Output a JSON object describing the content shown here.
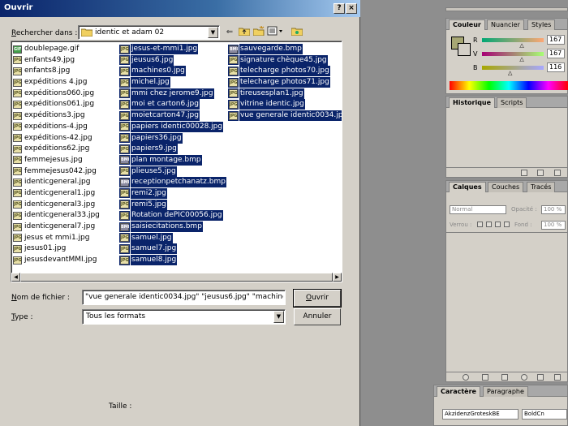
{
  "dialog": {
    "title": "Ouvrir",
    "help_glyph": "?",
    "close_glyph": "×",
    "look_in_label_u": "R",
    "look_in_label_rest": "echercher dans :",
    "look_in_value": "identic et adam 02",
    "toolbar_icons": [
      "back-icon",
      "up-folder-icon",
      "new-folder-icon",
      "view-menu-icon",
      "favorites-icon"
    ],
    "files": [
      [
        {
          "name": "doublepage.gif",
          "type": "gif",
          "selected": false
        },
        {
          "name": "enfants49.jpg",
          "type": "jpg",
          "selected": false
        },
        {
          "name": "enfants8.jpg",
          "type": "jpg",
          "selected": false
        },
        {
          "name": "expéditions 4.jpg",
          "type": "jpg",
          "selected": false
        },
        {
          "name": "expéditions060.jpg",
          "type": "jpg",
          "selected": false
        },
        {
          "name": "expéditions061.jpg",
          "type": "jpg",
          "selected": false
        },
        {
          "name": "expéditions3.jpg",
          "type": "jpg",
          "selected": false
        },
        {
          "name": "expéditions-4.jpg",
          "type": "jpg",
          "selected": false
        },
        {
          "name": "expéditions-42.jpg",
          "type": "jpg",
          "selected": false
        },
        {
          "name": "expéditions62.jpg",
          "type": "jpg",
          "selected": false
        },
        {
          "name": "femmejesus.jpg",
          "type": "jpg",
          "selected": false
        },
        {
          "name": "femmejesus042.jpg",
          "type": "jpg",
          "selected": false
        },
        {
          "name": "identicgeneral.jpg",
          "type": "jpg",
          "selected": false
        },
        {
          "name": "identicgeneral1.jpg",
          "type": "jpg",
          "selected": false
        },
        {
          "name": "identicgeneral3.jpg",
          "type": "jpg",
          "selected": false
        },
        {
          "name": "identicgeneral33.jpg",
          "type": "jpg",
          "selected": false
        },
        {
          "name": "identicgeneral7.jpg",
          "type": "jpg",
          "selected": false
        },
        {
          "name": "jesus et mmi1.jpg",
          "type": "jpg",
          "selected": false
        },
        {
          "name": "jesus01.jpg",
          "type": "jpg",
          "selected": false
        },
        {
          "name": "jesusdevantMMI.jpg",
          "type": "jpg",
          "selected": false
        }
      ],
      [
        {
          "name": "jesus-et-mmi1.jpg",
          "type": "jpg",
          "selected": true
        },
        {
          "name": "jeusus6.jpg",
          "type": "jpg",
          "selected": true
        },
        {
          "name": "machines0.jpg",
          "type": "jpg",
          "selected": true
        },
        {
          "name": "michel.jpg",
          "type": "jpg",
          "selected": true
        },
        {
          "name": "mmi chez jerome9.jpg",
          "type": "jpg",
          "selected": true
        },
        {
          "name": "moi et carton6.jpg",
          "type": "jpg",
          "selected": true
        },
        {
          "name": "moietcarton47.jpg",
          "type": "jpg",
          "selected": true
        },
        {
          "name": "papiers identic00028.jpg",
          "type": "jpg",
          "selected": true
        },
        {
          "name": "papiers36.jpg",
          "type": "jpg",
          "selected": true
        },
        {
          "name": "papiers9.jpg",
          "type": "jpg",
          "selected": true
        },
        {
          "name": "plan montage.bmp",
          "type": "bmp",
          "selected": true
        },
        {
          "name": "plieuse5.jpg",
          "type": "jpg",
          "selected": true
        },
        {
          "name": "receptionpetchanatz.bmp",
          "type": "bmp",
          "selected": true
        },
        {
          "name": "remi2.jpg",
          "type": "jpg",
          "selected": true
        },
        {
          "name": "remi5.jpg",
          "type": "jpg",
          "selected": true
        },
        {
          "name": "Rotation dePIC00056.jpg",
          "type": "jpg",
          "selected": true
        },
        {
          "name": "saisiecitations.bmp",
          "type": "bmp",
          "selected": true
        },
        {
          "name": "samuel.jpg",
          "type": "jpg",
          "selected": true
        },
        {
          "name": "samuel7.jpg",
          "type": "jpg",
          "selected": true
        },
        {
          "name": "samuel8.jpg",
          "type": "jpg",
          "selected": true
        }
      ],
      [
        {
          "name": "sauvegarde.bmp",
          "type": "bmp",
          "selected": true
        },
        {
          "name": "signature chèque45.jpg",
          "type": "jpg",
          "selected": true
        },
        {
          "name": "telecharge photos70.jpg",
          "type": "jpg",
          "selected": true
        },
        {
          "name": "telecharge photos71.jpg",
          "type": "jpg",
          "selected": true
        },
        {
          "name": "tireusesplan1.jpg",
          "type": "jpg",
          "selected": true
        },
        {
          "name": "vitrine identic.jpg",
          "type": "jpg",
          "selected": true
        },
        {
          "name": "vue generale identic0034.jpg",
          "type": "jpg",
          "selected": true
        }
      ]
    ],
    "filename_label_u": "N",
    "filename_label_rest": "om de fichier :",
    "filename_value": "\"vue generale identic0034.jpg\" \"jeusus6.jpg\" \"machines0.jpg\" \"m",
    "type_label_u": "T",
    "type_label_rest": "ype :",
    "type_value": "Tous les formats",
    "open_button_u": "O",
    "open_button_rest": "uvrir",
    "cancel_button": "Annuler",
    "size_label": "Taille :"
  },
  "color_panel": {
    "tabs": [
      "Couleur",
      "Nuancier",
      "Styles"
    ],
    "sliders": [
      {
        "label": "R",
        "value": "167",
        "pos": 0.65
      },
      {
        "label": "V",
        "value": "167",
        "pos": 0.65
      },
      {
        "label": "B",
        "value": "116",
        "pos": 0.46
      }
    ]
  },
  "history_panel": {
    "tabs": [
      "Historique",
      "Scripts"
    ]
  },
  "layers_panel": {
    "tabs": [
      "Calques",
      "Couches",
      "Tracés"
    ],
    "blend_mode": "Normal",
    "opacity_label": "Opacité :",
    "opacity_value": "100 %",
    "lock_label": "Verrou :",
    "fill_label": "Fond :",
    "fill_value": "100 %"
  },
  "character_panel": {
    "tabs": [
      "Caractère",
      "Paragraphe"
    ],
    "font_family": "AkzidenzGroteskBE",
    "font_style": "BoldCn"
  },
  "colors": {
    "title_active": "#0a246a",
    "selection": "#0a246a",
    "face": "#d4d0c8",
    "foreground_swatch": "#a7a774"
  }
}
